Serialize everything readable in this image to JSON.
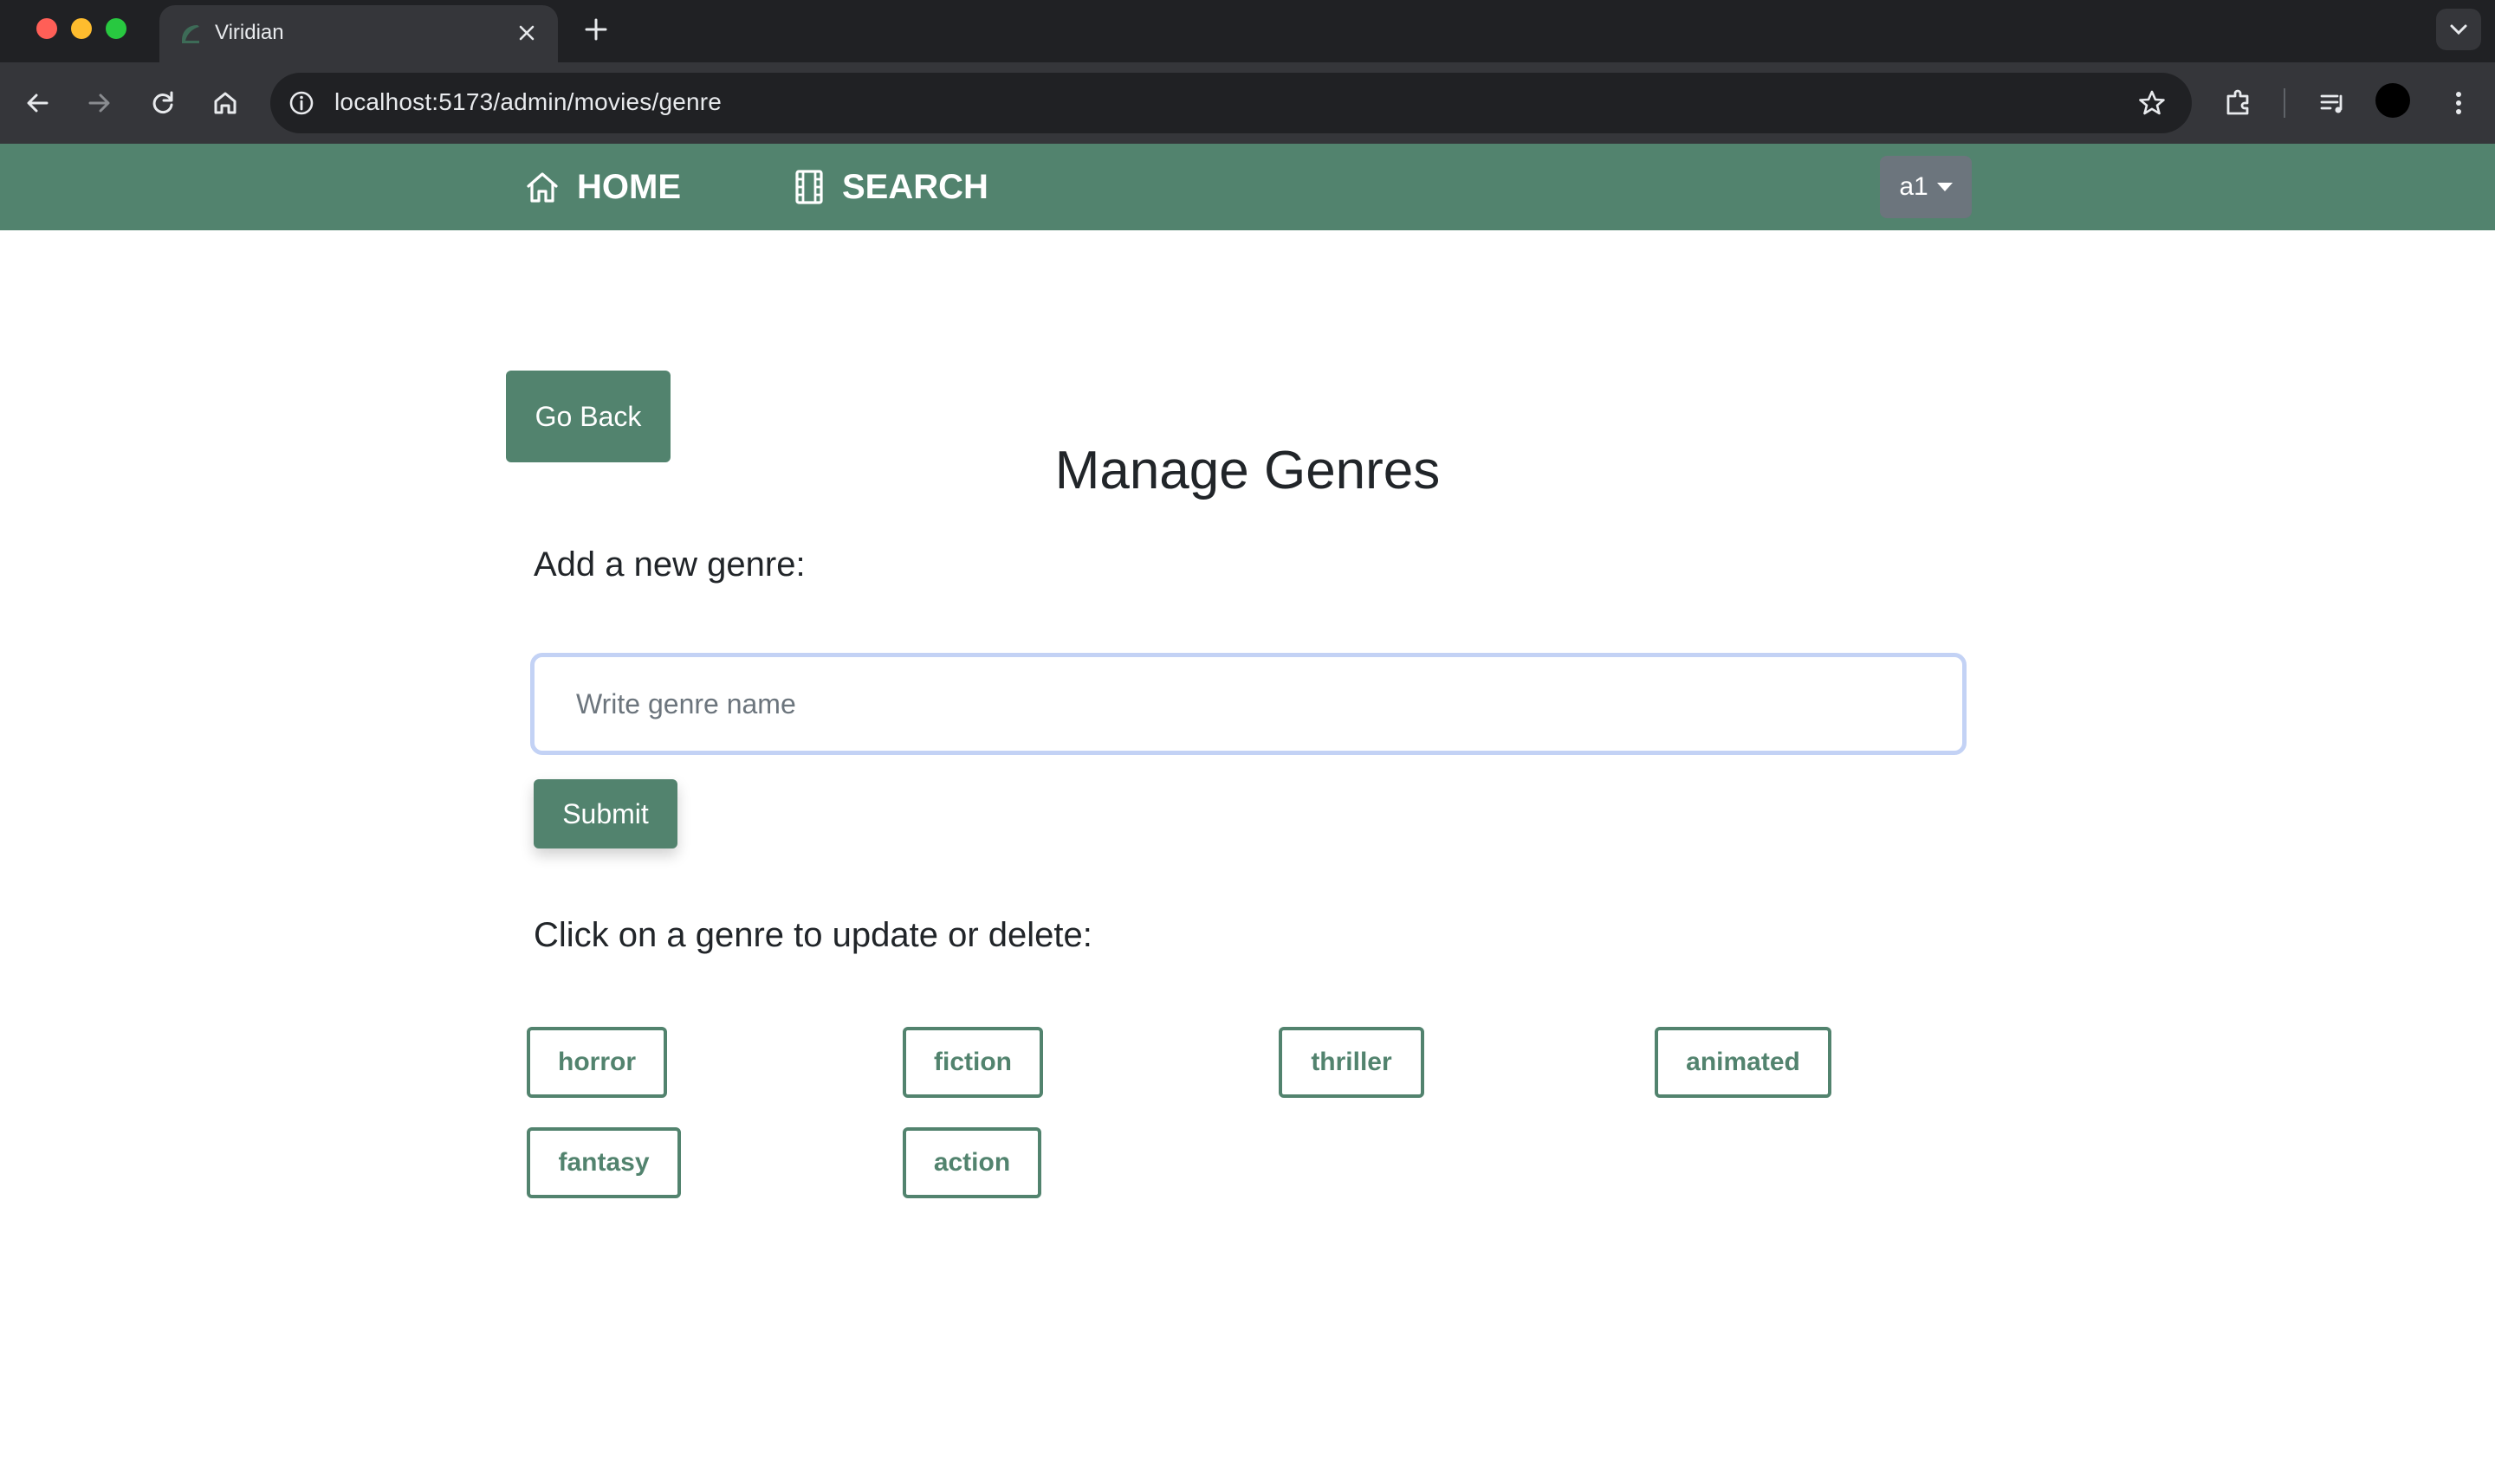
{
  "browser": {
    "tab_title": "Viridian",
    "url": "localhost:5173/admin/movies/genre"
  },
  "navbar": {
    "home_label": "HOME",
    "search_label": "SEARCH",
    "user_label": "a1",
    "color": "#52836e"
  },
  "page": {
    "go_back_label": "Go Back",
    "title": "Manage Genres",
    "add_label": "Add a new genre:",
    "input_placeholder": "Write genre name",
    "input_value": "",
    "submit_label": "Submit",
    "list_label": "Click on a genre to update or delete:",
    "genres": [
      "horror",
      "fiction",
      "thriller",
      "animated",
      "fantasy",
      "action"
    ]
  },
  "colors": {
    "accent": "#52836e",
    "focus_ring": "#c3d2f5"
  }
}
